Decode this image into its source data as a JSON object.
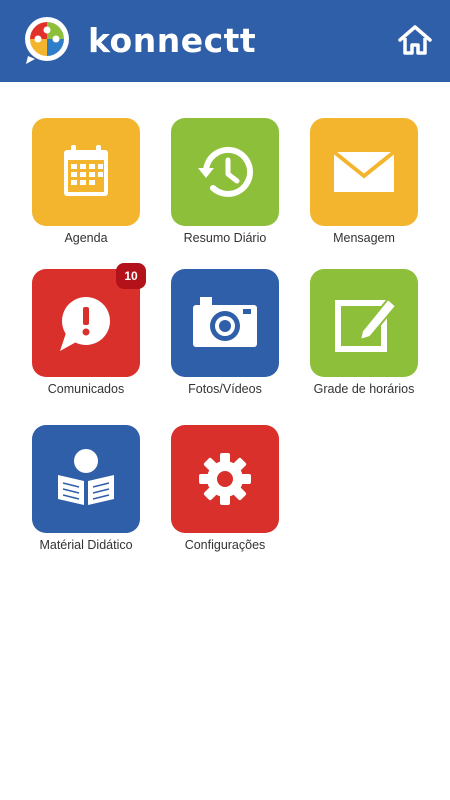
{
  "app": {
    "brand_name": "konnectt",
    "header_color": "#2f5fa8",
    "logo_icon": "puzzle-chat-logo-icon",
    "home_icon": "home-icon"
  },
  "tiles": [
    {
      "label": "Agenda",
      "icon": "calendar-icon",
      "color": "#f4b52e"
    },
    {
      "label": "Resumo Diário",
      "icon": "history-clock-icon",
      "color": "#8dbf3b"
    },
    {
      "label": "Mensagem",
      "icon": "envelope-icon",
      "color": "#f4b52e"
    },
    {
      "label": "Comunicados",
      "icon": "alert-chat-icon",
      "color": "#d9302c",
      "badge": "10"
    },
    {
      "label": "Fotos/Vídeos",
      "icon": "camera-icon",
      "color": "#2f5fa8"
    },
    {
      "label": "Grade de horários",
      "icon": "edit-pencil-icon",
      "color": "#8dbf3b"
    },
    {
      "label": "Matérial Didático",
      "icon": "reader-book-icon",
      "color": "#2f5fa8"
    },
    {
      "label": "Configurações",
      "icon": "gear-icon",
      "color": "#d9302c"
    }
  ]
}
